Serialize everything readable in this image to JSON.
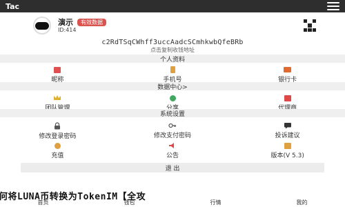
{
  "app": {
    "title": "Tac"
  },
  "profile": {
    "name": "演示",
    "badge": "有效数据",
    "id_label": "ID:414"
  },
  "wallet": {
    "address": "c2RdTSqCWhff3uccAadcSCmhkwbQfeBRb",
    "hint": "点击复制收钱地址"
  },
  "sections": {
    "personal": {
      "title": "个人资料",
      "items": [
        {
          "label": "昵称",
          "icon": "tag-icon",
          "color": "#e05050"
        },
        {
          "label": "手机号",
          "icon": "phone-icon",
          "color": "#e0a040"
        },
        {
          "label": "银行卡",
          "icon": "card-icon",
          "color": "#e06a30"
        }
      ]
    },
    "data": {
      "title": "数据中心>",
      "items": [
        {
          "label": "团队管理",
          "icon": "crown-icon",
          "color": "#e0b030"
        },
        {
          "label": "分享",
          "icon": "share-icon",
          "color": "#40a860"
        },
        {
          "label": "代理商",
          "icon": "agent-icon",
          "color": "#e04848"
        }
      ]
    },
    "system": {
      "title": "系统设置",
      "rows": [
        [
          {
            "label": "修改登录密码",
            "icon": "lock-icon",
            "color": "#555555"
          },
          {
            "label": "修改支付密码",
            "icon": "key-icon",
            "color": "#555555"
          },
          {
            "label": "投诉建议",
            "icon": "feedback-icon",
            "color": "#333333"
          }
        ],
        [
          {
            "label": "充值",
            "icon": "recharge-icon",
            "color": "#e0a040"
          },
          {
            "label": "公告",
            "icon": "notice-icon",
            "color": "#e04848"
          },
          {
            "label": "版本(V 5.3)",
            "icon": "version-icon",
            "color": "#e0a040"
          }
        ]
      ]
    }
  },
  "actions": {
    "logout": "退 出"
  },
  "article": {
    "headline": "何将LUNA币转换为TokenIM【全攻"
  },
  "bottom_nav": [
    "首页",
    "钱包",
    "行情",
    "我的"
  ]
}
